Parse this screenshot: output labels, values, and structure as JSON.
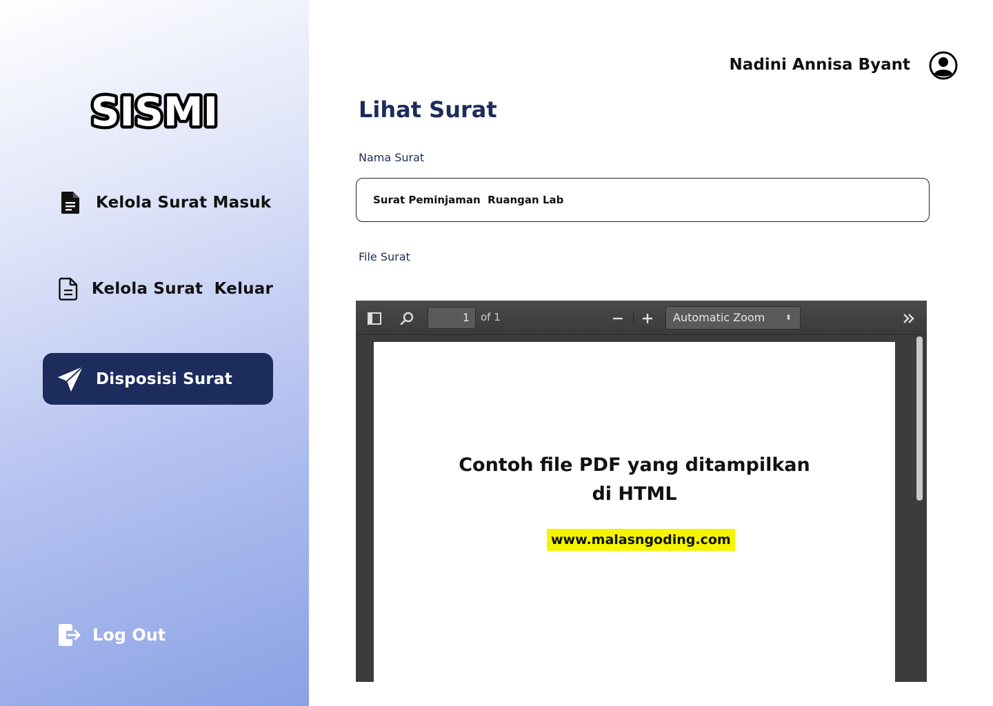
{
  "app": {
    "logo_text": "SISMI"
  },
  "sidebar": {
    "items": [
      {
        "label": "Kelola Surat Masuk",
        "icon": "document-filled-icon",
        "active": false
      },
      {
        "label": "Kelola Surat  Keluar",
        "icon": "document-outline-icon",
        "active": false
      },
      {
        "label": "Disposisi Surat",
        "icon": "send-icon",
        "active": true
      }
    ],
    "logout_label": "Log Out"
  },
  "header": {
    "user_name": "Nadini Annisa Byant",
    "avatar_icon": "user-circle-icon"
  },
  "main": {
    "title": "Lihat Surat",
    "nama_label": "Nama Surat",
    "nama_value": "Surat Peminjaman  Ruangan Lab",
    "file_label": "File Surat"
  },
  "pdf_viewer": {
    "page_number": "1",
    "page_of": "of 1",
    "zoom": "Automatic Zoom",
    "document_heading_line1": "Contoh file PDF yang ditampilkan",
    "document_heading_line2": "di HTML",
    "document_link": "www.malasngoding.com"
  },
  "colors": {
    "primary": "#1c2c5c",
    "highlight": "#f5f500",
    "viewer_bg": "#3c3c3c"
  }
}
